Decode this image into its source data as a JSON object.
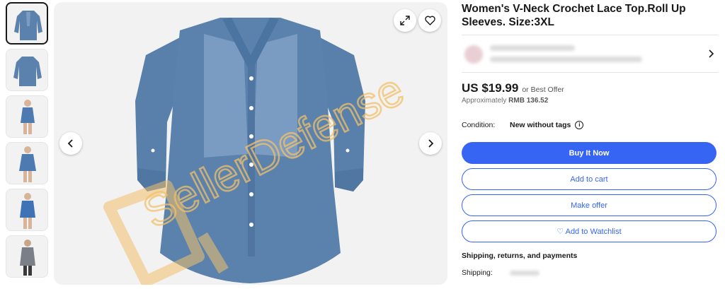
{
  "product": {
    "title": "Women's V-Neck Crochet Lace Top.Roll Up Sleeves. Size:3XL"
  },
  "watermark": {
    "text": "SellerDefense"
  },
  "price": {
    "main": "US $19.99",
    "offer": "or Best Offer",
    "approx_label": "Approximately",
    "approx_value": "RMB 136.52"
  },
  "condition": {
    "label": "Condition:",
    "value": "New without tags",
    "info_glyph": "i"
  },
  "buttons": {
    "buy": "Buy It Now",
    "cart": "Add to cart",
    "offer": "Make offer",
    "watch": "♡ Add to Watchlist"
  },
  "shipping": {
    "heading": "Shipping, returns, and payments",
    "label": "Shipping:"
  },
  "colors": {
    "accent": "#3665f3",
    "shirt": "#5a82ad",
    "watermark": "#f3c069"
  }
}
